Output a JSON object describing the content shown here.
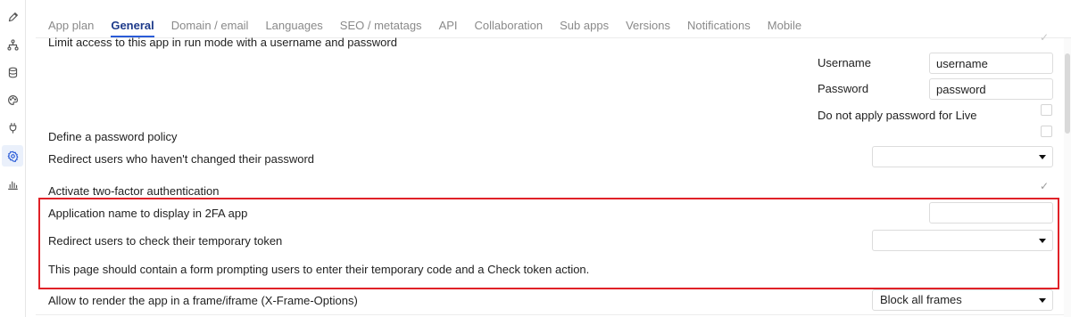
{
  "tabs": [
    {
      "label": "App plan"
    },
    {
      "label": "General"
    },
    {
      "label": "Domain / email"
    },
    {
      "label": "Languages"
    },
    {
      "label": "SEO / metatags"
    },
    {
      "label": "API"
    },
    {
      "label": "Collaboration"
    },
    {
      "label": "Sub apps"
    },
    {
      "label": "Versions"
    },
    {
      "label": "Notifications"
    },
    {
      "label": "Mobile"
    }
  ],
  "sidebar_icons": [
    "pencil-icon",
    "hierarchy-icon",
    "database-icon",
    "palette-icon",
    "plug-icon",
    "settings-icon",
    "chart-icon"
  ],
  "access": {
    "label": "Limit access to this app in run mode with a username and password",
    "username_label": "Username",
    "username_value": "username",
    "password_label": "Password",
    "password_value": "password",
    "no_password_live_label": "Do not apply password for Live"
  },
  "password_policy": {
    "label": "Define a password policy"
  },
  "redirect_password": {
    "label": "Redirect users who haven't changed their password",
    "value": ""
  },
  "two_factor": {
    "label": "Activate two-factor authentication",
    "checked": true,
    "app_name_label": "Application name to display in 2FA app",
    "app_name_value": "",
    "redirect_token_label": "Redirect users to check their temporary token",
    "redirect_token_value": "",
    "hint": "This page should contain a form prompting users to enter their temporary code and a Check token action."
  },
  "frame": {
    "label": "Allow to render the app in a frame/iframe (X-Frame-Options)",
    "value": "Block all frames"
  },
  "colors": {
    "accent": "#2a5bd7",
    "highlight_border": "#e02127"
  }
}
